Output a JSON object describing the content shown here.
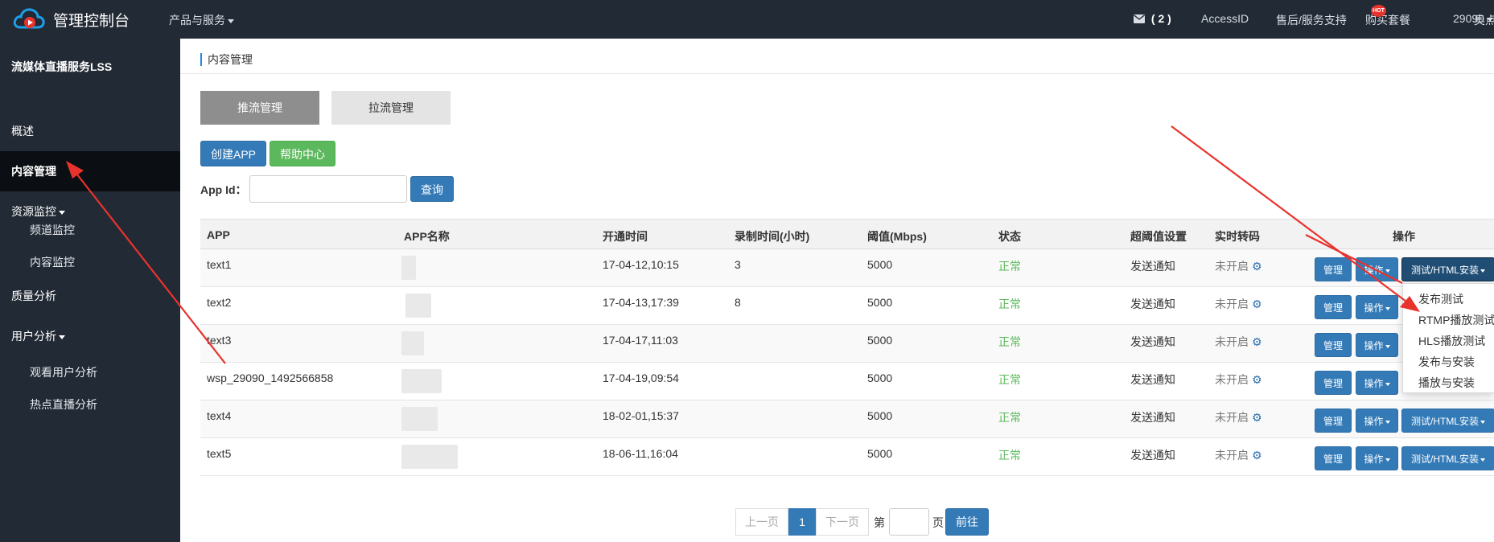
{
  "topbar": {
    "brand": "管理控制台",
    "products_menu": "产品与服务",
    "messages_count": "( 2 )",
    "access_id": "AccessID",
    "support": "售后/服务支持",
    "buy_package": "购买套餐",
    "hot_badge": "HOT",
    "user_id": "29090",
    "cut_off_item": "奥点"
  },
  "sidebar": {
    "title": "流媒体直播服务LSS",
    "items": [
      {
        "label": "概述"
      },
      {
        "label": "内容管理"
      },
      {
        "label": "资源监控"
      },
      {
        "label": "频道监控"
      },
      {
        "label": "内容监控"
      },
      {
        "label": "质量分析"
      },
      {
        "label": "用户分析"
      },
      {
        "label": "观看用户分析"
      },
      {
        "label": "热点直播分析"
      }
    ]
  },
  "main": {
    "breadcrumb": "内容管理",
    "tabs": [
      {
        "label": "推流管理"
      },
      {
        "label": "拉流管理"
      }
    ],
    "create_app_button": "创建APP",
    "help_center_button": "帮助中心",
    "appid_label": "App Id：",
    "appid_value": "",
    "query_button": "查询"
  },
  "table": {
    "columns": [
      "APP",
      "APP名称",
      "开通时间",
      "录制时间(小时)",
      "阈值(Mbps)",
      "状态",
      "超阈值设置",
      "实时转码",
      "操作"
    ],
    "rows": [
      {
        "app": "text1",
        "open_time": "17-04-12,10:15",
        "record_hours": "3",
        "threshold": "5000",
        "status": "正常",
        "over_threshold": "发送通知",
        "transcode": "未开启"
      },
      {
        "app": "text2",
        "open_time": "17-04-13,17:39",
        "record_hours": "8",
        "threshold": "5000",
        "status": "正常",
        "over_threshold": "发送通知",
        "transcode": "未开启"
      },
      {
        "app": "text3",
        "open_time": "17-04-17,11:03",
        "record_hours": "",
        "threshold": "5000",
        "status": "正常",
        "over_threshold": "发送通知",
        "transcode": "未开启"
      },
      {
        "app": "wsp_29090_1492566858",
        "open_time": "17-04-19,09:54",
        "record_hours": "",
        "threshold": "5000",
        "status": "正常",
        "over_threshold": "发送通知",
        "transcode": "未开启"
      },
      {
        "app": "text4",
        "open_time": "18-02-01,15:37",
        "record_hours": "",
        "threshold": "5000",
        "status": "正常",
        "over_threshold": "发送通知",
        "transcode": "未开启"
      },
      {
        "app": "text5",
        "open_time": "18-06-11,16:04",
        "record_hours": "",
        "threshold": "5000",
        "status": "正常",
        "over_threshold": "发送通知",
        "transcode": "未开启"
      }
    ],
    "manage_label": "管理",
    "operate_label": "操作",
    "test_install_label": "测试/HTML安装"
  },
  "dropdown": {
    "items": [
      "发布测试",
      "RTMP播放测试",
      "HLS播放测试",
      "发布与安装",
      "播放与安装"
    ]
  },
  "pagination": {
    "prev": "上一页",
    "current": "1",
    "next": "下一页",
    "goto_prefix": "第",
    "goto_suffix": "页",
    "go_button": "前往"
  },
  "colors": {
    "navbar_bg": "#222a35",
    "primary": "#337ab7",
    "success": "#5cb85c",
    "status_ok": "#5cb85c",
    "annotation_arrow": "#e8332d"
  }
}
